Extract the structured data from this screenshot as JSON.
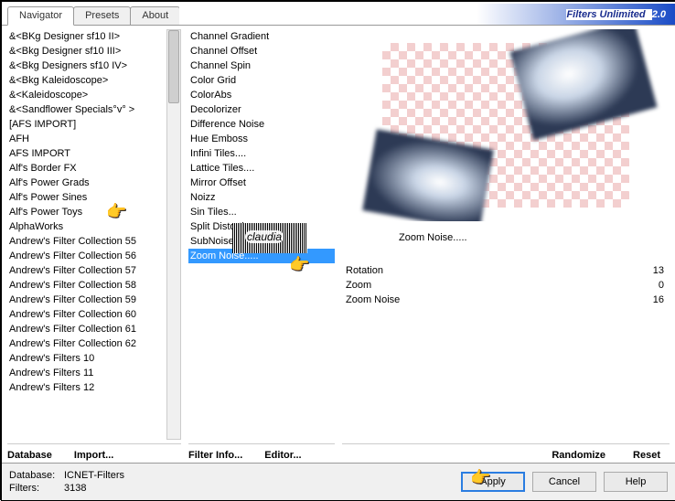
{
  "tabs": {
    "navigator": "Navigator",
    "presets": "Presets",
    "about": "About"
  },
  "title_a": "Filters Unlimited ",
  "title_b": "2.0",
  "categories": [
    "&<BKg Designer sf10 II>",
    "&<Bkg Designer sf10 III>",
    "&<Bkg Designers sf10 IV>",
    "&<Bkg Kaleidoscope>",
    "&<Kaleidoscope>",
    "&<Sandflower Specials°v° >",
    "[AFS IMPORT]",
    "AFH",
    "AFS IMPORT",
    "Alf's Border FX",
    "Alf's Power Grads",
    "Alf's Power Sines",
    "Alf's Power Toys",
    "AlphaWorks",
    "Andrew's Filter Collection 55",
    "Andrew's Filter Collection 56",
    "Andrew's Filter Collection 57",
    "Andrew's Filter Collection 58",
    "Andrew's Filter Collection 59",
    "Andrew's Filter Collection 60",
    "Andrew's Filter Collection 61",
    "Andrew's Filter Collection 62",
    "Andrew's Filters 10",
    "Andrew's Filters 11",
    "Andrew's Filters 12"
  ],
  "filters": [
    "Channel Gradient",
    "Channel Offset",
    "Channel Spin",
    "Color Grid",
    "ColorAbs",
    "Decolorizer",
    "Difference Noise",
    "Hue Emboss",
    "Infini Tiles....",
    "Lattice Tiles....",
    "Mirror Offset",
    "Noizz",
    "Sin Tiles...",
    "Split Distortion",
    "SubNoise",
    "Zoom Noise....."
  ],
  "selected_filter_index": 15,
  "selected_filter_label": "Zoom Noise.....",
  "params": [
    {
      "name": "Rotation",
      "value": "13"
    },
    {
      "name": "Zoom",
      "value": "0"
    },
    {
      "name": "Zoom Noise",
      "value": "16"
    }
  ],
  "buttons": {
    "database": "Database",
    "import": "Import...",
    "filter_info": "Filter Info...",
    "editor": "Editor...",
    "randomize": "Randomize",
    "reset": "Reset",
    "apply": "Apply",
    "cancel": "Cancel",
    "help": "Help"
  },
  "footer": {
    "db_label": "Database:",
    "db_value": "ICNET-Filters",
    "filters_label": "Filters:",
    "filters_value": "3138"
  }
}
